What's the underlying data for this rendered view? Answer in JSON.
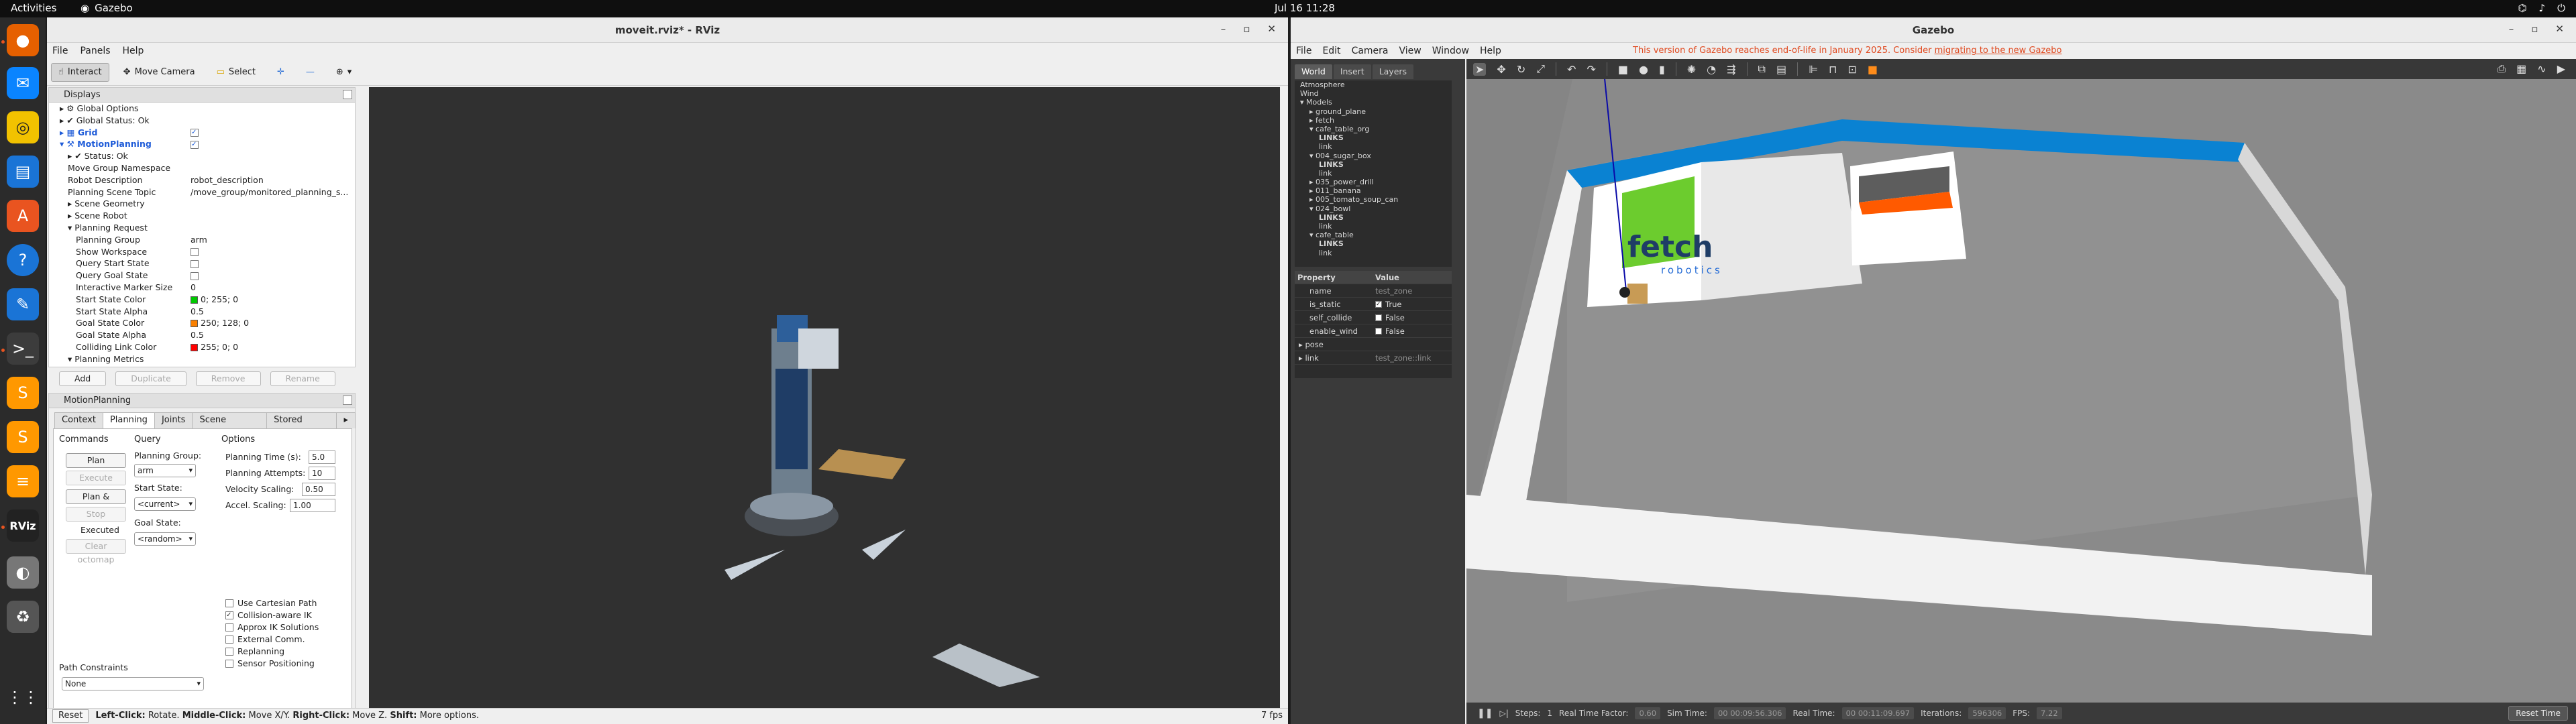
{
  "system": {
    "activities": "Activities",
    "focused_app": "Gazebo",
    "clock": "Jul 16  11:28"
  },
  "dock": {
    "items": [
      "firefox-icon",
      "thunderbird-icon",
      "rhythmbox-icon",
      "libreoffice-writer-icon",
      "app-center-icon",
      "help-icon",
      "text-editor-icon",
      "terminal-icon",
      "sublime-text-icon",
      "sublime-merge-icon",
      "layers-app-icon",
      "rviz-icon",
      "disk-icon",
      "trash-icon",
      "show-apps-icon"
    ]
  },
  "rviz": {
    "title": "moveit.rviz* - RViz",
    "menu": [
      "File",
      "Panels",
      "Help"
    ],
    "toolbar": {
      "interact": "Interact",
      "move_camera": "Move Camera",
      "select": "Select"
    },
    "displays": {
      "header": "Displays",
      "rows": [
        {
          "name": "Global Options",
          "value": "",
          "indent": 1,
          "icon": "gear"
        },
        {
          "name": "Global Status: Ok",
          "value": "",
          "indent": 1,
          "icon": "check"
        },
        {
          "name": "Grid",
          "value": "checked",
          "indent": 1,
          "icon": "grid",
          "blue": true
        },
        {
          "name": "MotionPlanning",
          "value": "checked",
          "indent": 1,
          "icon": "arm",
          "blue": true,
          "expanded": true
        },
        {
          "name": "Status: Ok",
          "value": "",
          "indent": 2,
          "icon": "check"
        },
        {
          "name": "Move Group Namespace",
          "value": "",
          "indent": 2
        },
        {
          "name": "Robot Description",
          "value": "robot_description",
          "indent": 2
        },
        {
          "name": "Planning Scene Topic",
          "value": "/move_group/monitored_planning_s...",
          "indent": 2
        },
        {
          "name": "Scene Geometry",
          "value": "",
          "indent": 2,
          "collapsed": true
        },
        {
          "name": "Scene Robot",
          "value": "",
          "indent": 2,
          "collapsed": true
        },
        {
          "name": "Planning Request",
          "value": "",
          "indent": 2,
          "expanded": true
        },
        {
          "name": "Planning Group",
          "value": "arm",
          "indent": 3
        },
        {
          "name": "Show Workspace",
          "value": "unchecked",
          "indent": 3
        },
        {
          "name": "Query Start State",
          "value": "unchecked",
          "indent": 3
        },
        {
          "name": "Query Goal State",
          "value": "unchecked",
          "indent": 3
        },
        {
          "name": "Interactive Marker Size",
          "value": "0",
          "indent": 3
        },
        {
          "name": "Start State Color",
          "value": "0; 255; 0",
          "indent": 3,
          "swatch": "#00c800"
        },
        {
          "name": "Start State Alpha",
          "value": "0.5",
          "indent": 3
        },
        {
          "name": "Goal State Color",
          "value": "250; 128; 0",
          "indent": 3,
          "swatch": "#fa8000"
        },
        {
          "name": "Goal State Alpha",
          "value": "0.5",
          "indent": 3
        },
        {
          "name": "Colliding Link Color",
          "value": "255; 0; 0",
          "indent": 3,
          "swatch": "#ff0000"
        },
        {
          "name": "Planning Metrics",
          "value": "",
          "indent": 2,
          "expanded": true
        }
      ],
      "buttons": [
        "Add",
        "Duplicate",
        "Remove",
        "Rename"
      ]
    },
    "motion_planning": {
      "header": "MotionPlanning",
      "tabs": [
        "Context",
        "Planning",
        "Joints",
        "Scene Objects",
        "Stored Scene"
      ],
      "commands_label": "Commands",
      "query_label": "Query",
      "options_label": "Options",
      "buttons": {
        "plan": "Plan",
        "execute": "Execute",
        "plan_execute": "Plan & Execute",
        "stop": "Stop",
        "executed": "Executed",
        "clear_octomap": "Clear octomap"
      },
      "planning_group_label": "Planning Group:",
      "planning_group_value": "arm",
      "start_state_label": "Start State:",
      "start_state_value": "<current>",
      "goal_state_label": "Goal State:",
      "goal_state_value": "<random>",
      "planning_time_label": "Planning Time (s):",
      "planning_time_value": "5.0",
      "planning_attempts_label": "Planning Attempts:",
      "planning_attempts_value": "10",
      "velocity_label": "Velocity Scaling:",
      "velocity_value": "0.50",
      "accel_label": "Accel. Scaling:",
      "accel_value": "1.00",
      "checks": [
        {
          "label": "Use Cartesian Path",
          "checked": false
        },
        {
          "label": "Collision-aware IK",
          "checked": true
        },
        {
          "label": "Approx IK Solutions",
          "checked": false
        },
        {
          "label": "External Comm.",
          "checked": false
        },
        {
          "label": "Replanning",
          "checked": false
        },
        {
          "label": "Sensor Positioning",
          "checked": false
        }
      ],
      "path_constraints_label": "Path Constraints",
      "path_constraints_value": "None"
    },
    "status": {
      "reset": "Reset",
      "hint_left": "Left-Click:",
      "hint_left_t": "Rotate.",
      "hint_mid": "Middle-Click:",
      "hint_mid_t": "Move X/Y.",
      "hint_right": "Right-Click:",
      "hint_right_t": "Move Z.",
      "hint_shift": "Shift:",
      "hint_shift_t": "More options.",
      "fps": "7 fps"
    }
  },
  "gazebo": {
    "title": "Gazebo",
    "menu": [
      "File",
      "Edit",
      "Camera",
      "View",
      "Window",
      "Help"
    ],
    "warning": "This version of Gazebo reaches end-of-life in January 2025. Consider",
    "warning_link": "migrating to the new Gazebo",
    "tabs": [
      "World",
      "Insert",
      "Layers"
    ],
    "tree": [
      {
        "label": "Atmosphere",
        "indent": 0
      },
      {
        "label": "Wind",
        "indent": 0
      },
      {
        "label": "Models",
        "indent": 0,
        "open": true
      },
      {
        "label": "ground_plane",
        "indent": 1,
        "arrow": true
      },
      {
        "label": "fetch",
        "indent": 1,
        "arrow": true
      },
      {
        "label": "cafe_table_org",
        "indent": 1,
        "open": true
      },
      {
        "label": "LINKS",
        "indent": 2,
        "bold": true
      },
      {
        "label": "link",
        "indent": 2
      },
      {
        "label": "004_sugar_box",
        "indent": 1,
        "open": true
      },
      {
        "label": "LINKS",
        "indent": 2,
        "bold": true
      },
      {
        "label": "link",
        "indent": 2
      },
      {
        "label": "035_power_drill",
        "indent": 1,
        "arrow": true
      },
      {
        "label": "011_banana",
        "indent": 1,
        "arrow": true
      },
      {
        "label": "005_tomato_soup_can",
        "indent": 1,
        "arrow": true
      },
      {
        "label": "024_bowl",
        "indent": 1,
        "open": true
      },
      {
        "label": "LINKS",
        "indent": 2,
        "bold": true
      },
      {
        "label": "link",
        "indent": 2
      },
      {
        "label": "cafe_table",
        "indent": 1,
        "open": true
      },
      {
        "label": "LINKS",
        "indent": 2,
        "bold": true
      },
      {
        "label": "link",
        "indent": 2
      }
    ],
    "props_header": {
      "k": "Property",
      "v": "Value"
    },
    "props": [
      {
        "k": "name",
        "v": "test_zone",
        "dim": true
      },
      {
        "k": "is_static",
        "v": "True",
        "check": true
      },
      {
        "k": "self_collide",
        "v": "False",
        "check": false
      },
      {
        "k": "enable_wind",
        "v": "False",
        "check": false
      },
      {
        "k": "pose",
        "v": "",
        "arrow": true
      },
      {
        "k": "link",
        "v": "test_zone::link",
        "arrow": true,
        "dim": true
      }
    ],
    "bottom": {
      "steps_label": "Steps:",
      "steps_value": "1",
      "rtf_label": "Real Time Factor:",
      "rtf_value": "0.60",
      "sim_label": "Sim Time:",
      "sim_value": "00 00:09:56.306",
      "real_label": "Real Time:",
      "real_value": "00 00:11:09.697",
      "iter_label": "Iterations:",
      "iter_value": "596306",
      "fps_label": "FPS:",
      "fps_value": "7.22",
      "reset": "Reset Time"
    },
    "scene_logo": "fetch",
    "scene_logo_sub": "robotics"
  },
  "colors": {
    "ubuntu_accent": "#e95420",
    "gz_warning": "#e0491f",
    "wall_blue": "#0a82d2",
    "wall_green": "#6ccc2e",
    "wall_orange": "#ff5a00"
  }
}
